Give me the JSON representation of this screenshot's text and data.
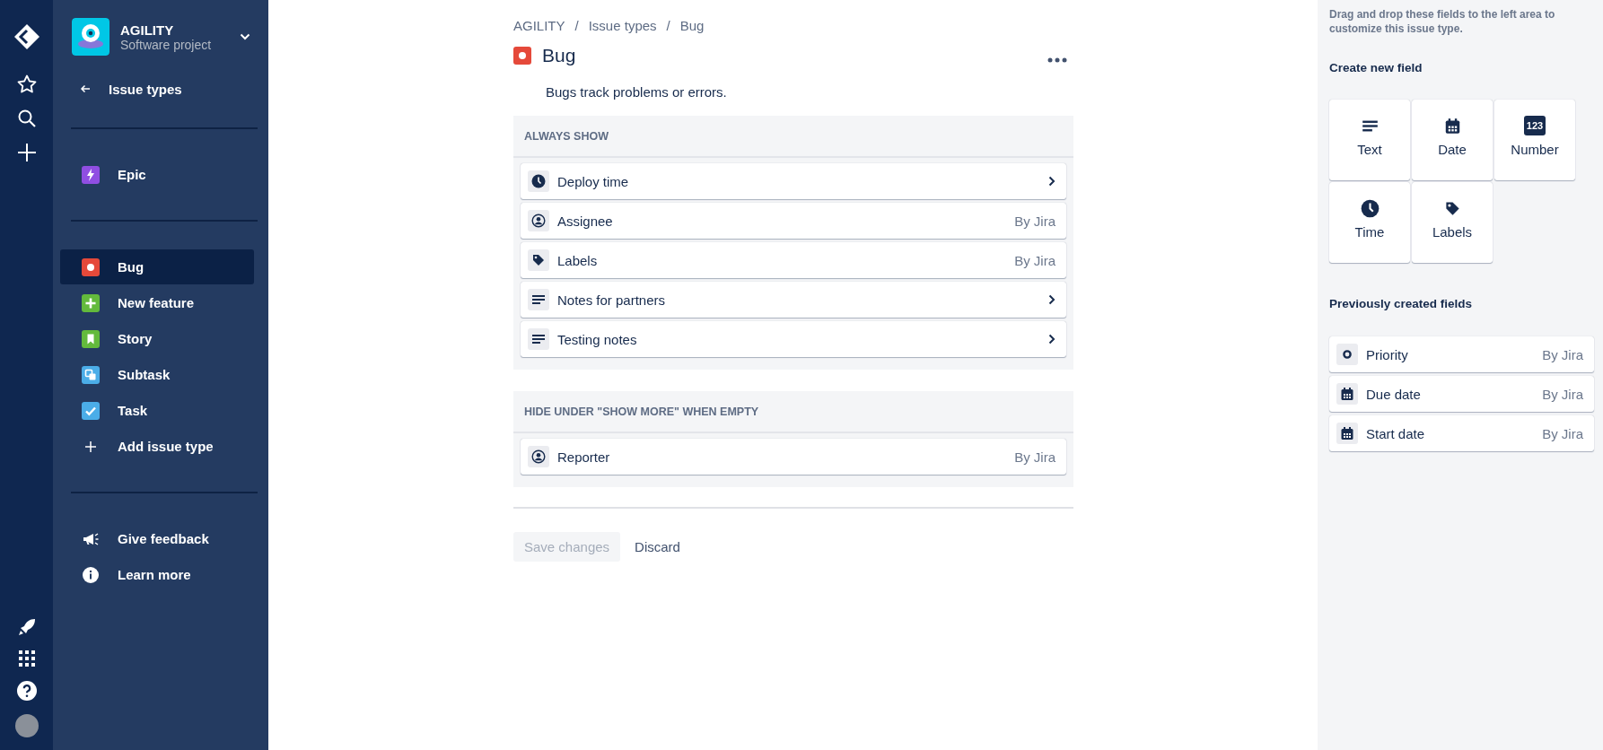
{
  "sidebar": {
    "project": {
      "name": "AGILITY",
      "type": "Software project"
    },
    "back_link": "Issue types",
    "groups": [
      [
        {
          "label": "Epic",
          "kind": "epic",
          "color": "#904ee2",
          "selected": false
        }
      ],
      [
        {
          "label": "Bug",
          "kind": "bug",
          "color": "#e5493a",
          "selected": true
        },
        {
          "label": "New feature",
          "kind": "feature",
          "color": "#63ba3c",
          "selected": false
        },
        {
          "label": "Story",
          "kind": "story",
          "color": "#63ba3c",
          "selected": false
        },
        {
          "label": "Subtask",
          "kind": "subtask",
          "color": "#4bade8",
          "selected": false
        },
        {
          "label": "Task",
          "kind": "task",
          "color": "#4bade8",
          "selected": false
        },
        {
          "label": "Add issue type",
          "kind": "add",
          "selected": false
        }
      ],
      [
        {
          "label": "Give feedback",
          "kind": "feedback",
          "selected": false
        },
        {
          "label": "Learn more",
          "kind": "info",
          "selected": false
        }
      ]
    ]
  },
  "main": {
    "breadcrumbs": [
      {
        "kind": "link",
        "text": "AGILITY"
      },
      {
        "kind": "separator",
        "text": "/"
      },
      {
        "kind": "link",
        "text": "Issue types"
      },
      {
        "kind": "separator",
        "text": "/"
      },
      {
        "kind": "link",
        "text": "Bug"
      }
    ],
    "title": "Bug",
    "description": "Bugs track problems or errors.",
    "sections": [
      {
        "heading": "ALWAYS SHOW",
        "fields": [
          {
            "name": "Deploy time",
            "kind": "time"
          },
          {
            "name": "Assignee",
            "kind": "user",
            "meta": "By Jira"
          },
          {
            "name": "Labels",
            "kind": "label",
            "meta": "By Jira"
          },
          {
            "name": "Notes for partners",
            "kind": "text"
          },
          {
            "name": "Testing notes",
            "kind": "text"
          }
        ]
      },
      {
        "heading": "HIDE UNDER \"SHOW MORE\" WHEN EMPTY",
        "fields": [
          {
            "name": "Reporter",
            "kind": "user",
            "meta": "By Jira"
          }
        ]
      }
    ],
    "save_button": {
      "label": "Save changes",
      "disabled": true
    },
    "discard_button": {
      "label": "Discard"
    }
  },
  "panel": {
    "hint": "Drag and drop these fields to the left area to customize this issue type.",
    "create_heading": "Create new field",
    "field_types": [
      {
        "label": "Text",
        "kind": "text"
      },
      {
        "label": "Date",
        "kind": "date"
      },
      {
        "label": "Number",
        "kind": "number",
        "badge": "123"
      },
      {
        "label": "Time",
        "kind": "time"
      },
      {
        "label": "Labels",
        "kind": "label"
      }
    ],
    "previous_heading": "Previously created fields",
    "previous_fields": [
      {
        "name": "Priority",
        "kind": "priority",
        "meta": "By Jira"
      },
      {
        "name": "Due date",
        "kind": "date",
        "meta": "By Jira"
      },
      {
        "name": "Start date",
        "kind": "date",
        "meta": "By Jira"
      }
    ]
  }
}
